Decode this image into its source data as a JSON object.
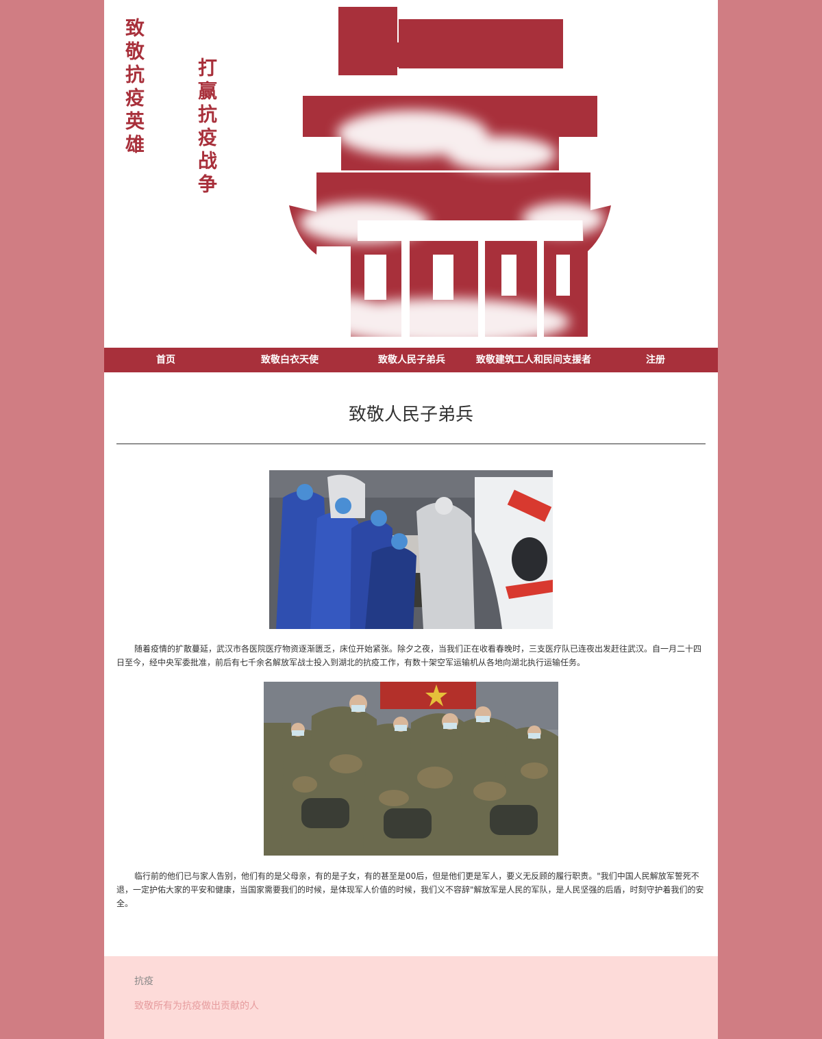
{
  "banner": {
    "slogan_left": "致敬抗疫英雄",
    "slogan_right": "打赢抗疫战争",
    "big_character": "赢",
    "brand_color": "#a8303b"
  },
  "nav": {
    "items": [
      {
        "label": "首页"
      },
      {
        "label": "致敬白衣天使"
      },
      {
        "label": "致敬人民子弟兵"
      },
      {
        "label": "致敬建筑工人和民间支援者"
      },
      {
        "label": "注册"
      }
    ]
  },
  "main": {
    "title": "致敬人民子弟兵",
    "paragraphs": [
      "随着疫情的扩散蔓延，武汉市各医院医疗物资逐渐匮乏，床位开始紧张。除夕之夜，当我们正在收看春晚时，三支医疗队已连夜出发赶往武汉。自一月二十四日至今，经中央军委批准，前后有七千余名解放军战士投入到湖北的抗疫工作，有数十架空军运输机从各地向湖北执行运输任务。",
      "临行前的他们已与家人告别，他们有的是父母亲，有的是子女，有的甚至是00后，但是他们更是军人，要义无反顾的履行职责。\"我们中国人民解放军誓死不退，一定护佑大家的平安和健康，当国家需要我们的时候，是体现军人价值的时候，我们义不容辞\"解放军是人民的军队，是人民坚强的后盾，时刻守护着我们的安全。"
    ]
  },
  "footer": {
    "heading": "抗疫",
    "tagline": "致敬所有为抗疫做出贡献的人"
  },
  "colors": {
    "page_background": "#d07d83",
    "nav_background": "#a8303b",
    "footer_background": "#fddbd9",
    "footer_tagline": "#e69b9d"
  }
}
